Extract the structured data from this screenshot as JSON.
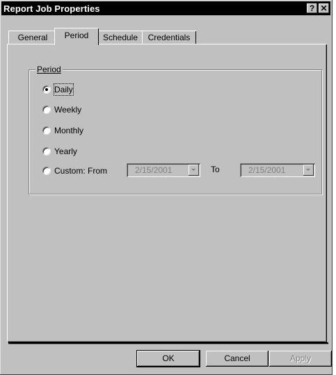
{
  "window": {
    "title": "Report Job Properties",
    "help_glyph": "?",
    "close_glyph": "✕"
  },
  "tabs": [
    {
      "label": "General",
      "active": false
    },
    {
      "label": "Period",
      "active": true
    },
    {
      "label": "Schedule",
      "active": false
    },
    {
      "label": "Credentials",
      "active": false
    }
  ],
  "period": {
    "group_label": "Period",
    "options": [
      {
        "label": "Daily",
        "selected": true
      },
      {
        "label": "Weekly",
        "selected": false
      },
      {
        "label": "Monthly",
        "selected": false
      },
      {
        "label": "Yearly",
        "selected": false
      },
      {
        "label": "Custom: From",
        "selected": false
      }
    ],
    "from_date": "2/15/2001",
    "to_label": "To",
    "to_date": "2/15/2001"
  },
  "buttons": {
    "ok": "OK",
    "cancel": "Cancel",
    "apply": "Apply"
  },
  "colors": {
    "face": "#c0c0c0",
    "titlebar": "#000000",
    "disabled_text": "#808080"
  }
}
